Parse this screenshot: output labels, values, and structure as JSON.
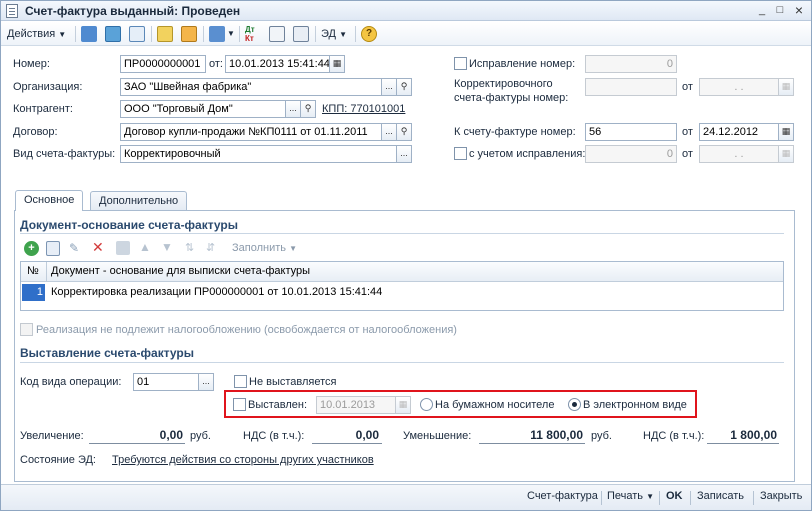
{
  "window": {
    "title": "Счет-фактура выданный: Проведен",
    "minimize": "_",
    "maximize": "□",
    "close": "×"
  },
  "toolbar": {
    "actions_label": "Действия",
    "ed_label": "ЭД",
    "help_label": "?"
  },
  "header": {
    "number_label": "Номер:",
    "number_value": "ПР0000000001",
    "from_label": "от:",
    "date_value": "10.01.2013 15:41:44",
    "org_label": "Организация:",
    "org_value": "ЗАО \"Швейная фабрика\"",
    "counterparty_label": "Контрагент:",
    "counterparty_value": "ООО \"Торговый Дом\"",
    "kpp_link": "КПП: 770101001",
    "contract_label": "Договор:",
    "contract_value": "Договор купли-продажи №КП0111 от 01.11.2011",
    "invoice_kind_label": "Вид счета-фактуры:",
    "invoice_kind_value": "Корректировочный"
  },
  "right": {
    "fix_number_label": "Исправление номер:",
    "fix_number_value": "0",
    "corr_number_label_1": "Корректировочного",
    "corr_number_label_2": "счета-фактуры номер:",
    "corr_from": "от",
    "corr_date_value": ". .",
    "to_invoice_label": "К счету-фактуре номер:",
    "to_invoice_value": "56",
    "to_invoice_from": "от",
    "to_invoice_date": "24.12.2012",
    "with_fix_label": "с учетом исправления:",
    "with_fix_value": "0",
    "with_fix_from": "от",
    "with_fix_date": ". ."
  },
  "tabs": [
    {
      "label": "Основное"
    },
    {
      "label": "Дополнительно"
    }
  ],
  "basis": {
    "section_title": "Документ-основание счета-фактуры",
    "fill_label": "Заполнить",
    "col_num": "№",
    "col_doc": "Документ - основание для выписки счета-фактуры",
    "rows": [
      {
        "num": "1",
        "doc": "Корректировка реализации ПР000000001 от 10.01.2013 15:41:44"
      }
    ],
    "tax_exempt_label": "Реализация не подлежит налогообложению (освобождается от налогообложения)"
  },
  "issue": {
    "section_title": "Выставление счета-фактуры",
    "op_code_label": "Код вида операции:",
    "op_code_value": "01",
    "not_issued_label": "Не выставляется",
    "issued_label": "Выставлен:",
    "issued_date": "10.01.2013",
    "paper_label": "На бумажном носителе",
    "electronic_label": "В электронном виде",
    "selected_mode": "electronic"
  },
  "totals": {
    "increase_label": "Увеличение:",
    "increase_value": "0,00",
    "rub1": "руб.",
    "vat1_label": "НДС (в т.ч.):",
    "vat1_value": "0,00",
    "decrease_label": "Уменьшение:",
    "decrease_value": "11 800,00",
    "rub2": "руб.",
    "vat2_label": "НДС (в т.ч.):",
    "vat2_value": "1 800,00"
  },
  "ed_state": {
    "label": "Состояние ЭД:",
    "link": "Требуются действия со стороны других участников"
  },
  "footer": {
    "invoice": "Счет-фактура",
    "print": "Печать",
    "ok": "OK",
    "save": "Записать",
    "close": "Закрыть"
  },
  "colors": {
    "accent": "#2b4a6e",
    "highlight_box": "#e0141c",
    "selection": "#2f6fc9"
  }
}
